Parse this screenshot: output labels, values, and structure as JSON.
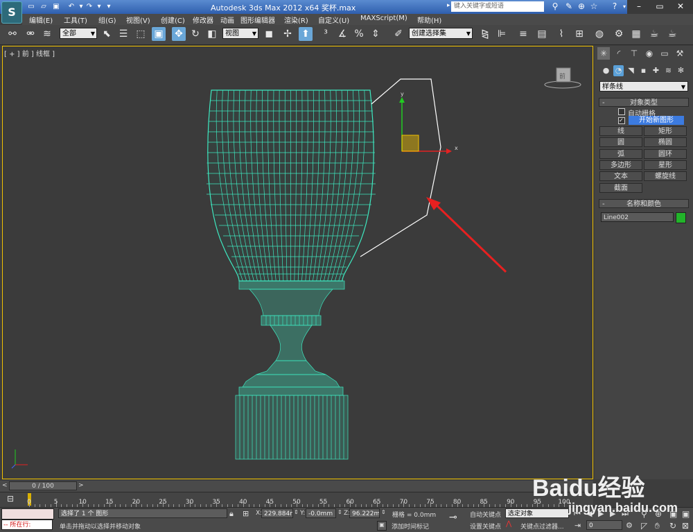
{
  "title_bar": {
    "title": "Autodesk 3ds Max  2012  x64   奖杯.max",
    "search_placeholder": "键入关键字或短语",
    "app_logo": "3ds-max-logo"
  },
  "menu": [
    "编辑(E)",
    "工具(T)",
    "组(G)",
    "视图(V)",
    "创建(C)",
    "修改器",
    "动画",
    "图形编辑器",
    "渲染(R)",
    "自定义(U)",
    "MAXScript(M)",
    "帮助(H)"
  ],
  "toolbar": {
    "selection_filter": "全部",
    "reference_coord": "视图",
    "named_selection_placeholder": "创建选择集"
  },
  "viewport": {
    "label": "[ + ] 前 ] 线框 ]",
    "viewcube_label": "前"
  },
  "command_panel": {
    "category_dropdown": "样条线",
    "object_type": {
      "header": "对象类型",
      "autogrid_label": "自动栅格",
      "autogrid_checked": false,
      "start_new_shape_label": "开始新图形",
      "start_new_shape_checked": true,
      "buttons": [
        "线",
        "矩形",
        "圆",
        "椭圆",
        "弧",
        "圆环",
        "多边形",
        "星形",
        "文本",
        "螺旋线",
        "截面"
      ]
    },
    "name_color": {
      "header": "名称和颜色",
      "name": "Line002",
      "color": "#22b42a"
    }
  },
  "time_slider": {
    "frame": "0 / 100",
    "prev_icon": "chevron-left-icon",
    "next_icon": "chevron-right-icon"
  },
  "trackbar": {
    "tick_labels": [
      "0",
      "5",
      "10",
      "15",
      "20",
      "25",
      "30",
      "35",
      "40",
      "45",
      "50",
      "55",
      "60",
      "65",
      "70",
      "75",
      "80",
      "85",
      "90",
      "95",
      "100"
    ]
  },
  "status_bar": {
    "maxscript_listener": "所在行:",
    "selection_info": "选择了 1 个 图形",
    "prompt": "单击并拖动以选择并移动对象",
    "x_label": "X:",
    "x_value": "229.884mr",
    "y_label": "Y:",
    "y_value": "-0.0mm",
    "z_label": "Z:",
    "z_value": "96.222mm",
    "grid": "栅格 = 0.0mm",
    "add_time_tag": "添加时间标记",
    "auto_key": "自动关键点",
    "set_key": "设置关键点",
    "selected_object": "选定对象",
    "key_filters": "关键点过滤器...",
    "frame_field": "0"
  },
  "watermark": {
    "brand": "Baidu经验",
    "url": "jingyan.baidu.com"
  },
  "colors": {
    "wireframe": "#3ee8c0",
    "spline": "#ffffff",
    "annotation_arrow": "#e82020",
    "viewport_border": "#f2c200",
    "gizmo_x": "#e52222",
    "gizmo_y": "#22cc22"
  }
}
